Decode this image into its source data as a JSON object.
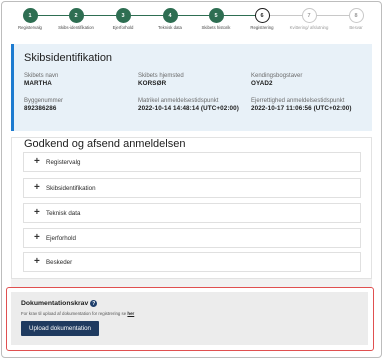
{
  "stepper": {
    "steps": [
      {
        "num": "1",
        "label": "Registervalg",
        "state": "done"
      },
      {
        "num": "2",
        "label": "Skibs-identifikation",
        "state": "done"
      },
      {
        "num": "3",
        "label": "Ejerforhold",
        "state": "done"
      },
      {
        "num": "4",
        "label": "Teknisk data",
        "state": "done"
      },
      {
        "num": "5",
        "label": "Skibets historik",
        "state": "done"
      },
      {
        "num": "6",
        "label": "Registrering",
        "state": "current"
      },
      {
        "num": "7",
        "label": "Kvittering/ afslutning",
        "state": "todo"
      },
      {
        "num": "8",
        "label": "Besvar",
        "state": "todo"
      }
    ],
    "colors": {
      "done": "#2e6e52",
      "current_border": "#1d1d1d",
      "todo_border": "#c8c8c8"
    }
  },
  "ship_card": {
    "title": "Skibsidentifikation",
    "fields": {
      "name_label": "Skibets navn",
      "name_value": "MARTHA",
      "home_label": "Skibets hjemsted",
      "home_value": "KORSØR",
      "callsign_label": "Kendingsbogstaver",
      "callsign_value": "OYAD2",
      "build_label": "Byggenummer",
      "build_value": "892386286",
      "reg_label": "Matrikel anmeldelsestidspunkt",
      "reg_value": "2022-10-14 14:48:14 (UTC+02:00)",
      "owner_label": "Ejerrettighed anmeldelsestidspunkt",
      "owner_value": "2022-10-17 11:06:56 (UTC+02:00)"
    },
    "accent_color": "#1d7bd0"
  },
  "approve": {
    "title": "Godkend og afsend anmeldelsen",
    "items": [
      {
        "label": "Registervalg"
      },
      {
        "label": "Skibsidentifikation"
      },
      {
        "label": "Teknisk data"
      },
      {
        "label": "Ejerforhold"
      },
      {
        "label": "Beskeder"
      }
    ],
    "expand_symbol": "+"
  },
  "documentation": {
    "heading": "Dokumentationskrav",
    "help_symbol": "?",
    "text": "For krav til upload af dokumentation for registrering se",
    "link_text": "her",
    "button_label": "Upload dokumentation",
    "highlight_color": "#e05050",
    "button_color": "#1f3a5f"
  }
}
